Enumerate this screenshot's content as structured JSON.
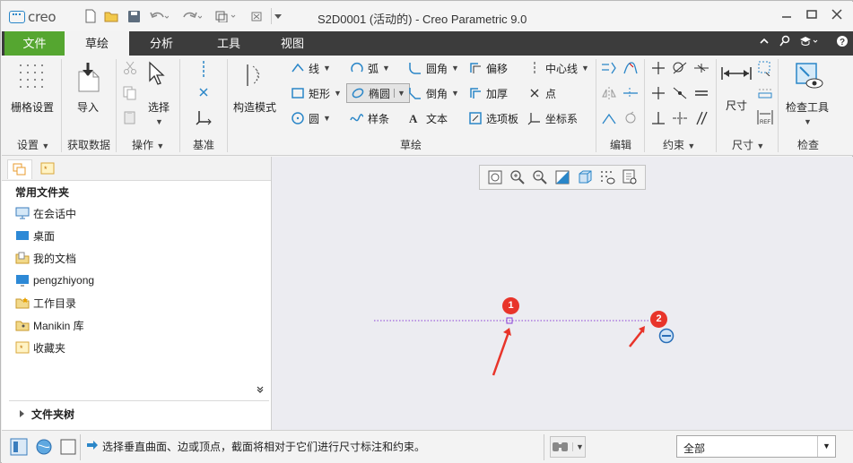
{
  "titlebar": {
    "brand": "creo",
    "title": "S2D0001 (活动的) - Creo Parametric 9.0"
  },
  "tabs": [
    {
      "label": "文件"
    },
    {
      "label": "草绘"
    },
    {
      "label": "分析"
    },
    {
      "label": "工具"
    },
    {
      "label": "视图"
    }
  ],
  "ribbon": {
    "groups": {
      "setup": "设置",
      "getdata": "获取数据",
      "operations": "操作",
      "datum": "基准",
      "sketch": "草绘",
      "edit": "编辑",
      "constrain": "约束",
      "dimension": "尺寸",
      "inspect": "检查"
    },
    "buttons": {
      "grid_settings": "栅格设置",
      "import": "导入",
      "select": "选择",
      "construction_mode": "构造模式",
      "line": "线",
      "arc": "弧",
      "fillet": "圆角",
      "offset": "偏移",
      "centerline": "中心线",
      "rectangle": "矩形",
      "ellipse": "椭圆",
      "chamfer": "倒角",
      "thicken": "加厚",
      "point": "点",
      "circle": "圆",
      "spline": "样条",
      "text": "文本",
      "palette": "选项板",
      "coordsys": "坐标系",
      "dimension": "尺寸",
      "inspect_tools": "检查工具"
    }
  },
  "leftpanel": {
    "header": "常用文件夹",
    "items": [
      {
        "label": "在会话中"
      },
      {
        "label": "桌面"
      },
      {
        "label": "我的文档"
      },
      {
        "label": "pengzhiyong"
      },
      {
        "label": "工作目录"
      },
      {
        "label": "Manikin 库"
      },
      {
        "label": "收藏夹"
      }
    ],
    "folder_tree": "文件夹树"
  },
  "statusbar": {
    "message": "选择垂直曲面、边或顶点，截面将相对于它们进行尺寸标注和约束。",
    "filter": "全部"
  },
  "markers": [
    "1",
    "2"
  ],
  "colors": {
    "file_tab": "#55a630",
    "tabbar": "#3c3c3c",
    "marker": "#e8342a",
    "accent": "#2a86c8",
    "graphics_bg": "#ececf1"
  }
}
